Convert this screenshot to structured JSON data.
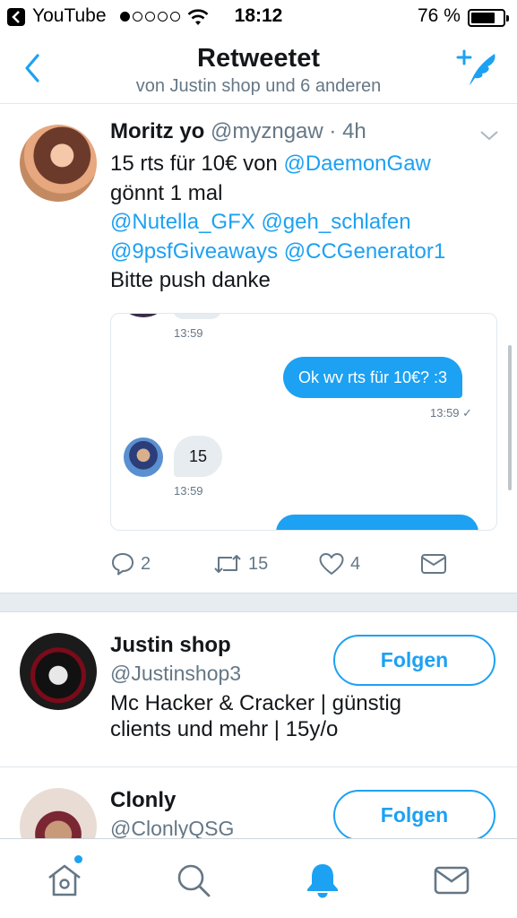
{
  "status_bar": {
    "back_app": "YouTube",
    "time": "18:12",
    "battery": "76 %",
    "battery_level": 0.76,
    "signal_bars": 1,
    "icons": [
      "signal-dots-icon",
      "wifi-icon",
      "battery-icon",
      "back-to-app-icon"
    ]
  },
  "header": {
    "title": "Retweetet",
    "subtitle": "von Justin shop und 6 anderen",
    "icons": [
      "back-chevron-icon",
      "compose-tweet-icon"
    ]
  },
  "tweet": {
    "name": "Moritz yo",
    "handle": "@myzngaw",
    "separator": "·",
    "time": "4h",
    "text_line1_plain": "15 rts für 10€ von ",
    "text_line1_mention": "@DaemonGaw",
    "text_line2": "gönnt 1 mal",
    "mention_a": "@Nutella_GFX",
    "mention_b": "@geh_schlafen",
    "mention_c": "@9psfGiveaways",
    "mention_d": "@CCGenerator1",
    "text_line5": "Bitte push danke",
    "media": {
      "ts1": "13:59",
      "out_message": "Ok wv rts für 10€? :3",
      "ts2": "13:59 ✓",
      "in_message": "15",
      "ts3": "13:59"
    },
    "actions": {
      "replies": "2",
      "retweets": "15",
      "likes": "4"
    },
    "accent_color": "#1da1f2"
  },
  "users": [
    {
      "name": "Justin shop",
      "handle": "@Justinshop3",
      "bio": "Mc Hacker & Cracker | günstig clients und mehr | 15y/o",
      "follow_label": "Folgen"
    },
    {
      "name": "Clonly",
      "handle": "@ClonlyQSG",
      "follow_label": "Folgen"
    }
  ],
  "tabbar": {
    "tabs": [
      "home-icon",
      "search-icon",
      "notifications-bell-icon",
      "messages-mail-icon"
    ],
    "active": "notifications-bell-icon",
    "home_has_new": true
  }
}
